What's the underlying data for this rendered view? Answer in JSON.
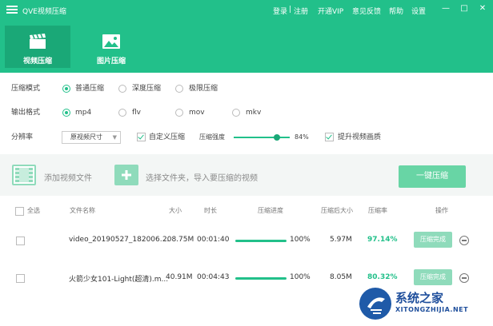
{
  "app": {
    "title": "QVE视频压缩",
    "nav": {
      "login": "登录",
      "sep": "|",
      "register": "注册",
      "vip": "开通VIP",
      "feedback": "意见反馈",
      "help": "帮助",
      "settings": "设置"
    },
    "window": {
      "minimize": "—",
      "maximize": "□",
      "close": "✕"
    },
    "brand_color": "#22c08a"
  },
  "tabs": [
    {
      "label": "视频压缩",
      "icon": "film-clapper-icon",
      "active": true
    },
    {
      "label": "图片压缩",
      "icon": "image-icon",
      "active": false
    }
  ],
  "settings": {
    "mode_label": "压缩模式",
    "modes": [
      "普通压缩",
      "深度压缩",
      "极限压缩"
    ],
    "mode_selected": "普通压缩",
    "format_label": "输出格式",
    "formats": [
      "mp4",
      "flv",
      "mov",
      "mkv"
    ],
    "format_selected": "mp4",
    "resolution_label": "分辨率",
    "resolution_value": "原视频尺寸",
    "custom_compress_label": "自定义压缩",
    "custom_compress_checked": true,
    "strength_label": "压缩强度",
    "strength_value": "84%",
    "strength_fraction": 0.84,
    "enhance_label": "提升视频画质",
    "enhance_checked": true
  },
  "toolbar": {
    "add_file": "添加视频文件",
    "add_folder": "选择文件夹，导入要压缩的视频",
    "compress_all": "一键压缩"
  },
  "table": {
    "headers": {
      "select_all": "全选",
      "name": "文件名称",
      "size": "大小",
      "duration": "时长",
      "progress": "压缩进度",
      "size_after": "压缩后大小",
      "rate": "压缩率",
      "action": "操作"
    },
    "rows": [
      {
        "name": "video_20190527_182006....",
        "size": "208.75M",
        "duration": "00:01:40",
        "progress": "100%",
        "progress_fraction": 1.0,
        "size_after": "5.97M",
        "rate": "97.14%",
        "status": "压缩完成"
      },
      {
        "name": "火箭少女101-Light(超清).m...",
        "size": "40.91M",
        "duration": "00:04:43",
        "progress": "100%",
        "progress_fraction": 1.0,
        "size_after": "8.05M",
        "rate": "80.32%",
        "status": "压缩完成"
      }
    ]
  },
  "watermark": {
    "text": "系统之家",
    "sub": "XITONGZHIJIA.NET"
  }
}
